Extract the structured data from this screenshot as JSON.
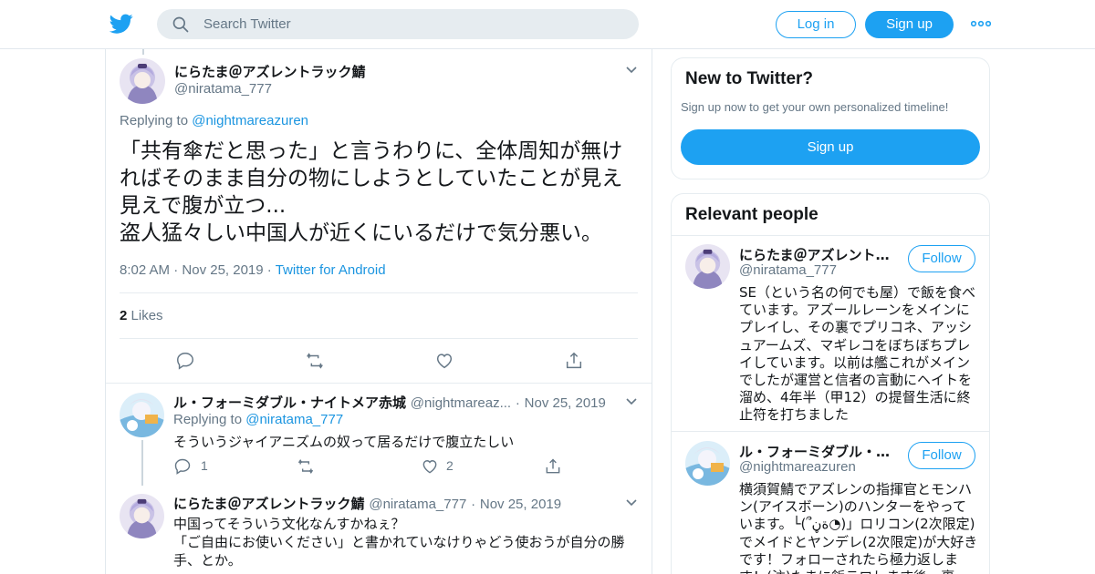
{
  "header": {
    "search_placeholder": "Search Twitter",
    "login_label": "Log in",
    "signup_label": "Sign up",
    "brand_color": "#1da1f2"
  },
  "main_tweet": {
    "name": "にらたま＠アズレントラック鯖",
    "handle": "@niratama_777",
    "replying_to_prefix": "Replying to ",
    "replying_to": "@nightmareazuren",
    "text": "「共有傘だと思った」と言うわりに、全体周知が無ければそのまま自分の物にしようとしていたことが見え見えで腹が立つ...\n盗人猛々しい中国人が近くにいるだけで気分悪い。",
    "time": "8:02 AM",
    "date": "Nov 25, 2019",
    "source": "Twitter for Android",
    "likes_count": "2",
    "likes_label": "Likes"
  },
  "replies": [
    {
      "name": "ル・フォーミダブル・ナイトメア赤城",
      "handle": "@nightmareaz...",
      "date": "Nov 25, 2019",
      "replying_to_prefix": "Replying to ",
      "replying_to": "@niratama_777",
      "text": "そういうジャイアニズムの奴って居るだけで腹立たしい",
      "reply_count": "1",
      "retweet_count": "",
      "like_count": "2"
    },
    {
      "name": "にらたま＠アズレントラック鯖",
      "handle": "@niratama_777",
      "date": "Nov 25, 2019",
      "text": "中国ってそういう文化なんすかねぇ？\n「ご自由にお使いください」と書かれていなけりゃどう使おうが自分の勝手、とか。"
    }
  ],
  "sidebar": {
    "new_title": "New to Twitter?",
    "new_sub": "Sign up now to get your own personalized timeline!",
    "new_signup": "Sign up",
    "relevant_title": "Relevant people",
    "people": [
      {
        "name": "にらたま＠アズレントラック鯖",
        "handle": "@niratama_777",
        "follow": "Follow",
        "bio": "SE（という名の何でも屋）で飯を食べています。アズールレーンをメインにプレイし、その裏でプリコネ、アッシュアームズ、マギレコをぼちぼちプレイしています。以前は艦これがメインでしたが運営と信者の言動にヘイトを溜め、4年半（甲12）の提督生活に終止符を打ちました"
      },
      {
        "name": "ル・フォーミダブル・ナイトメア赤城",
        "handle": "@nightmareazuren",
        "follow": "Follow",
        "bio": "横須賀鯖でアズレンの指揮官とモンハン(アイスボーン)のハンターをやっています。└(՞ةڼ◔)」ロリコン(2次限定)でメイドとヤンデレ(2次限定)が大好きです！フォローされたら極力返します！(注)たまに飯テロします後、裏"
      }
    ]
  }
}
